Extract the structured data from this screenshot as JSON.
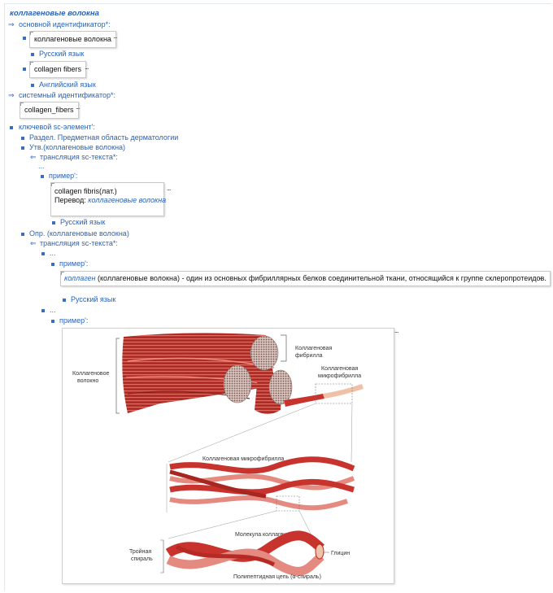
{
  "title": "коллагеновые волокна",
  "relations": {
    "main_id": "основной идентификатор*:",
    "system_id": "системный идентификатор*:",
    "key_sc": "ключевой sc-элемент':",
    "translation": "трансляция sc-текста*:",
    "example": "пример':"
  },
  "main_ids": [
    {
      "value": "коллагеновые волокна",
      "lang": "Русский язык"
    },
    {
      "value": "collagen fibers",
      "lang": "Английский язык"
    }
  ],
  "system_id_value": "collagen_fibers",
  "ellipsis": "...",
  "key_elements": {
    "section": "Раздел. Предметная область дерматологии",
    "statement": "Утв.(коллагеновые волокна)",
    "definition": "Опр. (коллагеновые волокна)"
  },
  "statement_example": {
    "line1": "collagen fibris(лат.)",
    "line2_prefix": "Перевод: ",
    "line2_term": "коллагеновые волокна",
    "lang": "Русский язык"
  },
  "definition_example": {
    "term": "коллаген",
    "text": " (коллагеновые волокна) - один из основных фибриллярных белков соединительной ткани, относящийся к группе склеропротеидов.",
    "lang": "Русский язык"
  },
  "illustration": {
    "label_fiber": [
      "Коллагеновое",
      "волокно"
    ],
    "label_fibril": [
      "Коллагеновая",
      "фибрилла"
    ],
    "label_microfibril": [
      "Коллагеновая",
      "микрофибрилла"
    ],
    "label_microfibril_mid": "Коллагеновая микрофибрилла",
    "label_molecule": "Молекула коллагена",
    "label_triple": [
      "Тройная",
      "спираль"
    ],
    "label_glycine": "Глицин",
    "label_chain": "Полипептидная цепь (α-спираль)"
  },
  "colors": {
    "link": "#2a62b5",
    "fiber": "#c8332d",
    "fiber_light": "#e58a80",
    "pale": "#efc2a8"
  }
}
